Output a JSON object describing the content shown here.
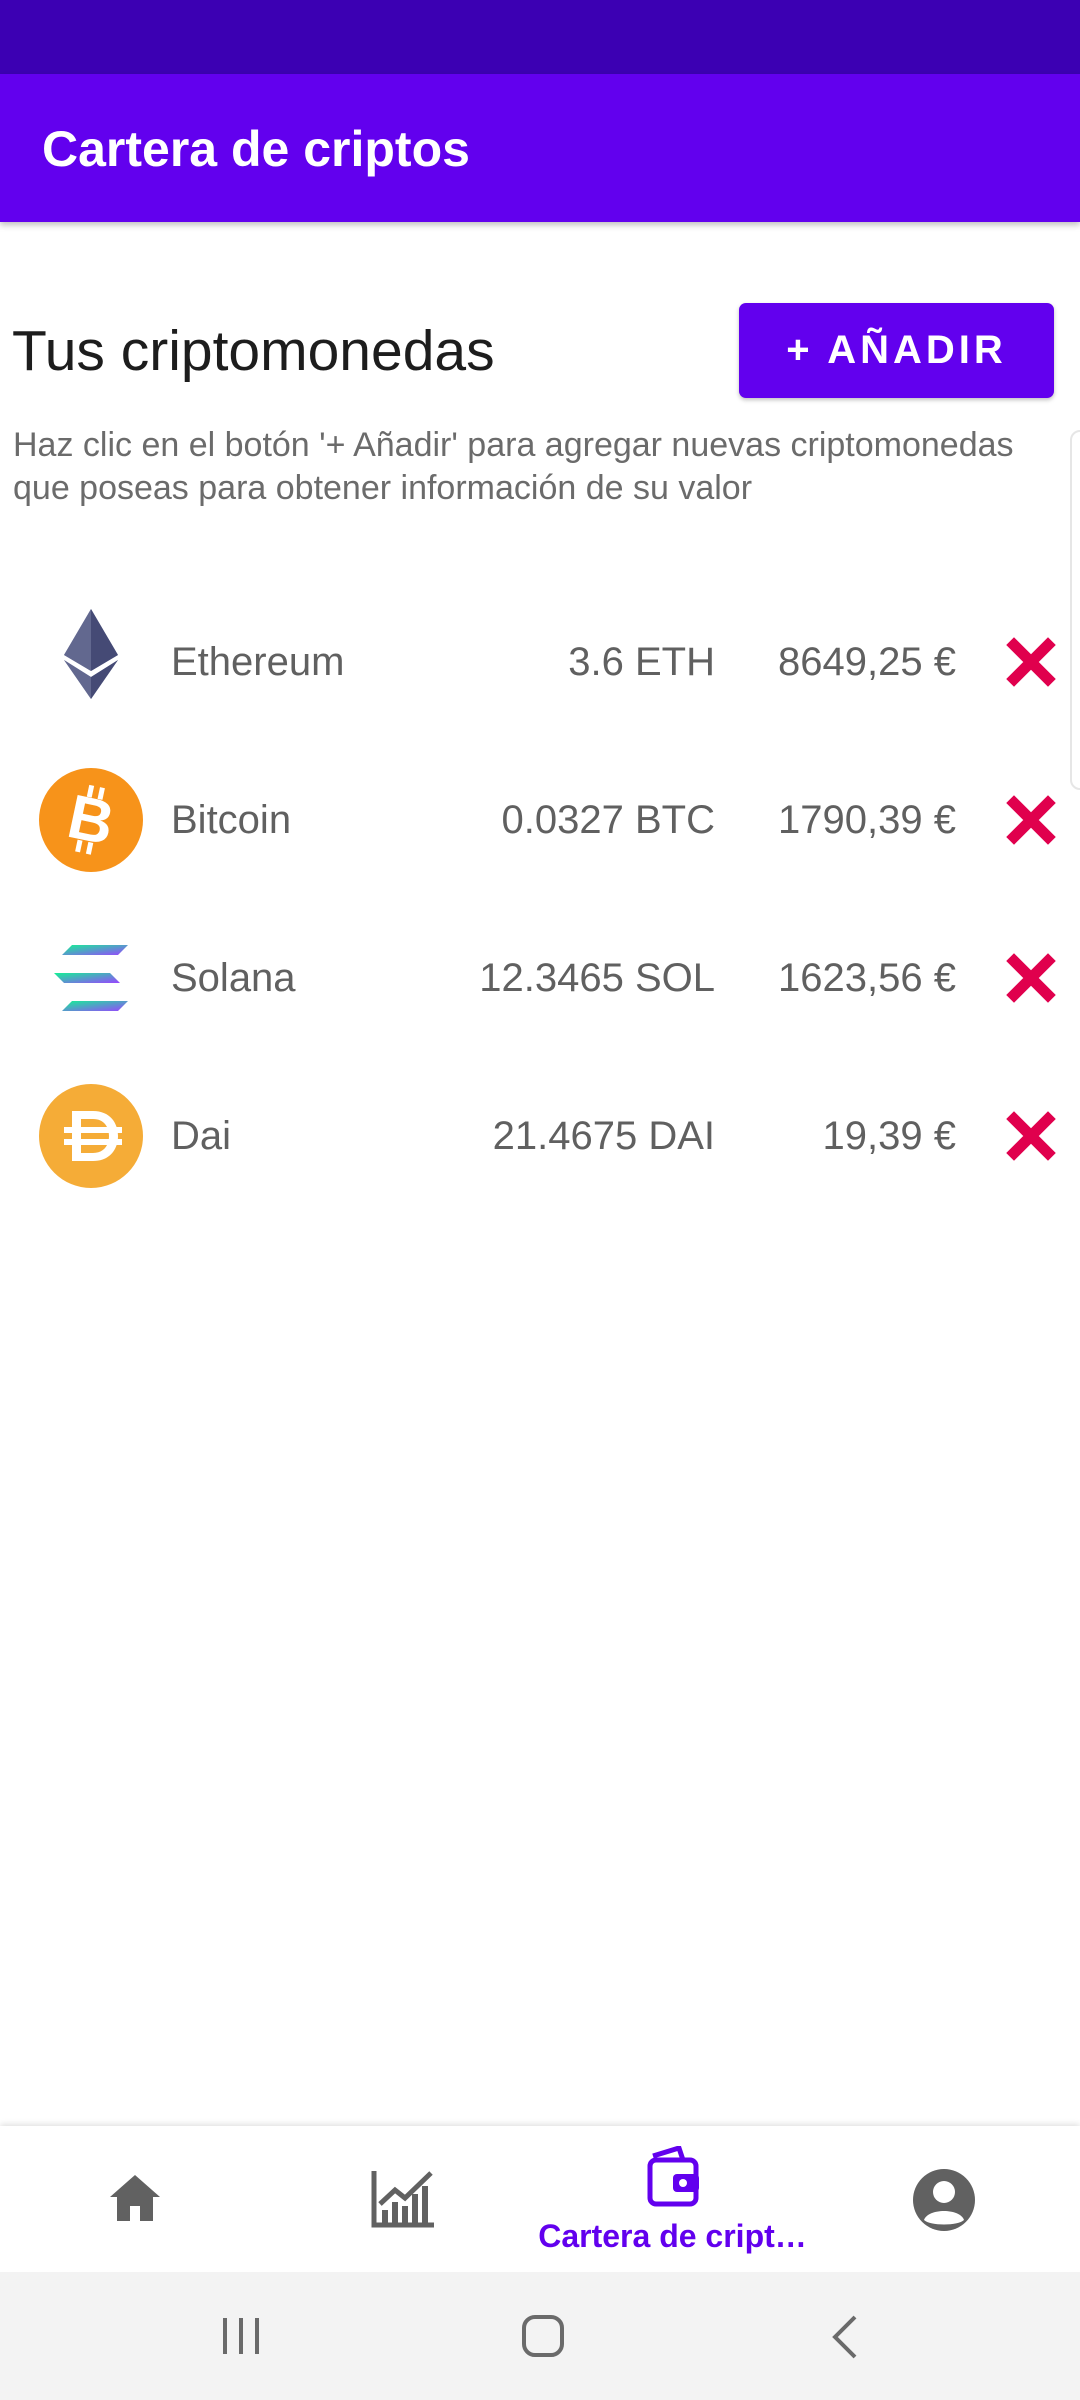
{
  "app_bar": {
    "title": "Cartera de criptos"
  },
  "header": {
    "title": "Tus criptomonedas",
    "add_button_label": "+ AÑADIR",
    "help_text": "Haz clic en el botón '+ Añadir' para agregar nuevas criptomonedas que poseas para obtener información de su valor"
  },
  "coins": [
    {
      "name": "Ethereum",
      "amount": "3.6 ETH",
      "value": "8649,25 €",
      "icon": "ethereum-icon"
    },
    {
      "name": "Bitcoin",
      "amount": "0.0327 BTC",
      "value": "1790,39 €",
      "icon": "bitcoin-icon"
    },
    {
      "name": "Solana",
      "amount": "12.3465 SOL",
      "value": "1623,56 €",
      "icon": "solana-icon"
    },
    {
      "name": "Dai",
      "amount": "21.4675 DAI",
      "value": "19,39 €",
      "icon": "dai-icon"
    }
  ],
  "bottom_nav": {
    "items": [
      {
        "icon": "home-icon",
        "label": ""
      },
      {
        "icon": "chart-icon",
        "label": ""
      },
      {
        "icon": "wallet-icon",
        "label": "Cartera de cript…",
        "selected": true
      },
      {
        "icon": "account-icon",
        "label": ""
      }
    ]
  },
  "colors": {
    "primary": "#6200ee",
    "status_bar": "#3c00b3",
    "delete": "#e0004d",
    "bitcoin": "#f7931a",
    "dai": "#f5ac37"
  }
}
